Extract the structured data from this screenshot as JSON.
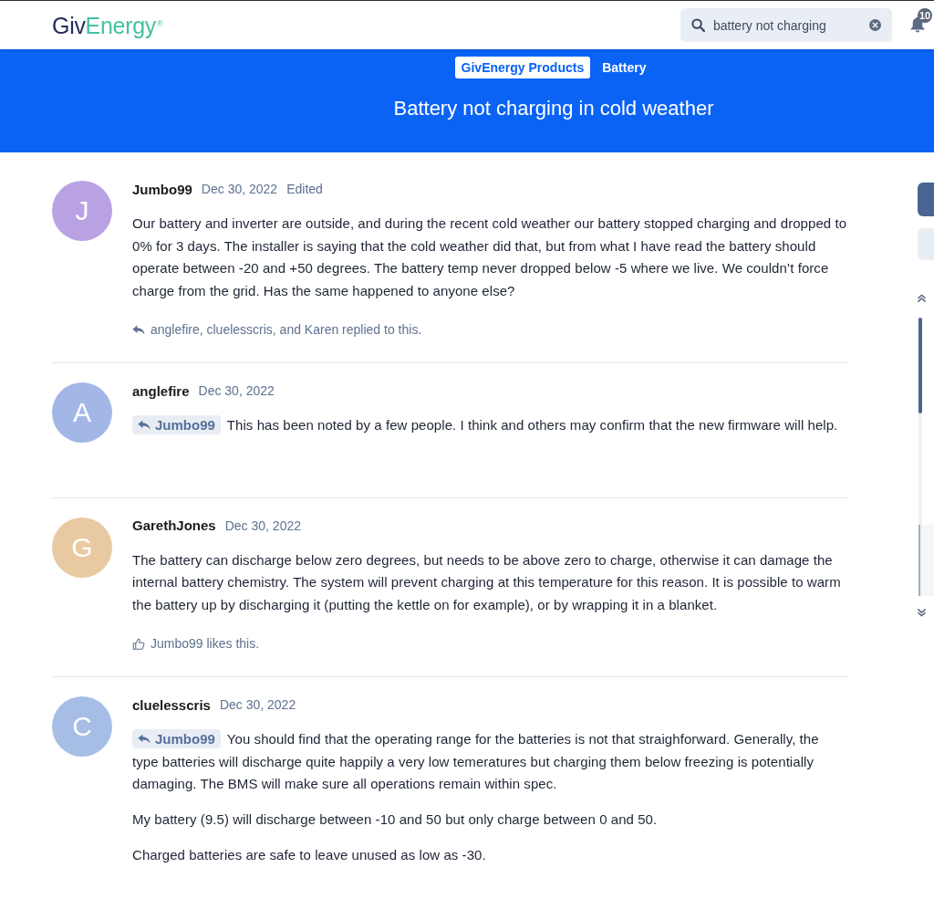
{
  "header": {
    "logo": {
      "part_1": "Giv",
      "part_2": "Energy",
      "mark": "®"
    },
    "search": {
      "value": "battery not charging"
    },
    "notifications": {
      "count": "10"
    }
  },
  "banner": {
    "breadcrumbs": [
      {
        "label": "GivEnergy Products",
        "selected": true
      },
      {
        "label": "Battery",
        "selected": false
      }
    ],
    "title": "Battery not charging in cold weather"
  },
  "posts": [
    {
      "avatar": {
        "letter": "J",
        "color": "#b9a2e4"
      },
      "author": "Jumbo99",
      "date": "Dec 30, 2022",
      "edit_note": "Edited",
      "paragraphs": [
        "Our battery and inverter are outside, and during the recent cold weather our battery stopped charging and dropped to 0% for 3 days. The installer is saying that the cold weather did that, but from what I have read the battery should operate between -20 and +50 degrees. The battery temp never dropped below -5 where we live. We couldn’t force charge from the grid. Has the same happened to anyone else?"
      ],
      "footer": {
        "kind": "replies",
        "text": "anglefire, cluelesscris, and Karen replied to this."
      }
    },
    {
      "avatar": {
        "letter": "A",
        "color": "#a3b7e6"
      },
      "author": "anglefire",
      "date": "Dec 30, 2022",
      "reply_to": "Jumbo99",
      "paragraphs": [
        "This has been noted by a few people. I think and others may confirm that the new firmware will help."
      ]
    },
    {
      "avatar": {
        "letter": "G",
        "color": "#e8c9a1"
      },
      "author": "GarethJones",
      "date": "Dec 30, 2022",
      "paragraphs": [
        "The battery can discharge below zero degrees, but needs to be above zero to charge, otherwise it can damage the internal battery chemistry. The system will prevent charging at this temperature for this reason. It is possible to warm the battery up by discharging it (putting the kettle on for example), or by wrapping it in a blanket."
      ],
      "footer": {
        "kind": "likes",
        "text": "Jumbo99 likes this."
      }
    },
    {
      "avatar": {
        "letter": "C",
        "color": "#a6bde6"
      },
      "author": "cluelesscris",
      "date": "Dec 30, 2022",
      "reply_to": "Jumbo99",
      "paragraphs": [
        "You should find that the operating range for the batteries is not that straighforward. Generally, the type batteries will discharge quite happily a very low temeratures but charging them below freezing is potentially damaging. The BMS will make sure all operations remain within spec.",
        "My battery (9.5) will discharge between -10 and 50 but only charge between 0 and 50.",
        "Charged batteries are safe to leave unused as low as -30."
      ]
    }
  ]
}
